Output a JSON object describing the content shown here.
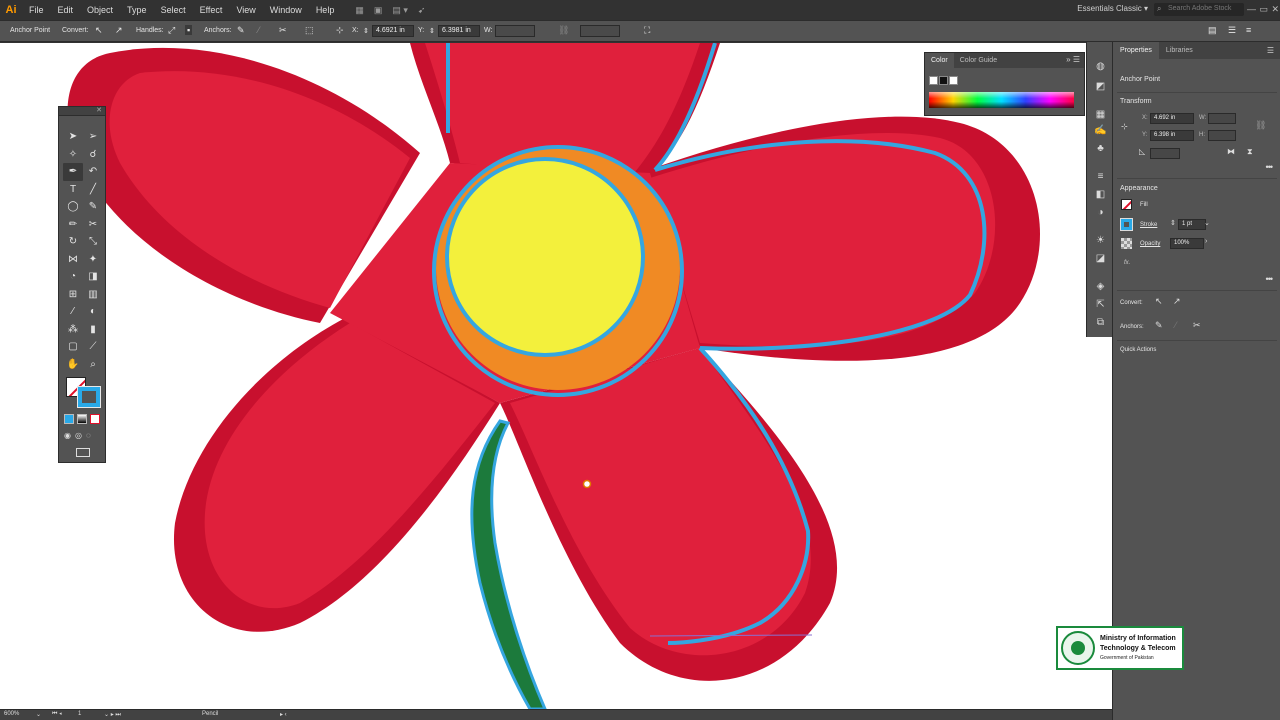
{
  "app": {
    "logo": "Ai",
    "menu": [
      "File",
      "Edit",
      "Object",
      "Type",
      "Select",
      "Effect",
      "View",
      "Window",
      "Help"
    ],
    "workspace": "Essentials Classic",
    "search_placeholder": "Search Adobe Stock"
  },
  "control_bar": {
    "tool_label": "Anchor Point",
    "convert_label": "Convert:",
    "handles_label": "Handles:",
    "anchors_label": "Anchors:",
    "x_label": "X:",
    "x_value": "4.6921 in",
    "y_label": "Y:",
    "y_value": "6.3981 in",
    "w_label": "W:"
  },
  "color_panel": {
    "tabs": [
      "Color",
      "Color Guide"
    ],
    "active_tab": "Color"
  },
  "properties": {
    "tabs": [
      "Properties",
      "Libraries"
    ],
    "active_tab": "Properties",
    "selection_label": "Anchor Point",
    "transform": {
      "title": "Transform",
      "x_label": "X:",
      "x_value": "4.692 in",
      "y_label": "Y:",
      "y_value": "6.398 in",
      "w_label": "W:",
      "h_label": "H:"
    },
    "appearance": {
      "title": "Appearance",
      "fill_label": "Fill",
      "stroke_label": "Stroke",
      "stroke_weight": "1 pt",
      "opacity_label": "Opacity",
      "opacity_value": "100%",
      "fx_label": "fx."
    },
    "convert_label": "Convert:",
    "anchors_label": "Anchors:",
    "quick_actions_label": "Quick Actions"
  },
  "status_bar": {
    "zoom": "600%",
    "artboard": "1",
    "tool": "Pencil"
  },
  "badge": {
    "line1": "Ministry of Information",
    "line2": "Technology & Telecom",
    "line3": "Government of Pakistan"
  },
  "colors": {
    "petal": "#e0203c",
    "petal_outline": "#c8102e",
    "center": "#f3f03c",
    "center_ring": "#f08a24",
    "path": "#35a6e0",
    "stem": "#1c7a3c"
  }
}
